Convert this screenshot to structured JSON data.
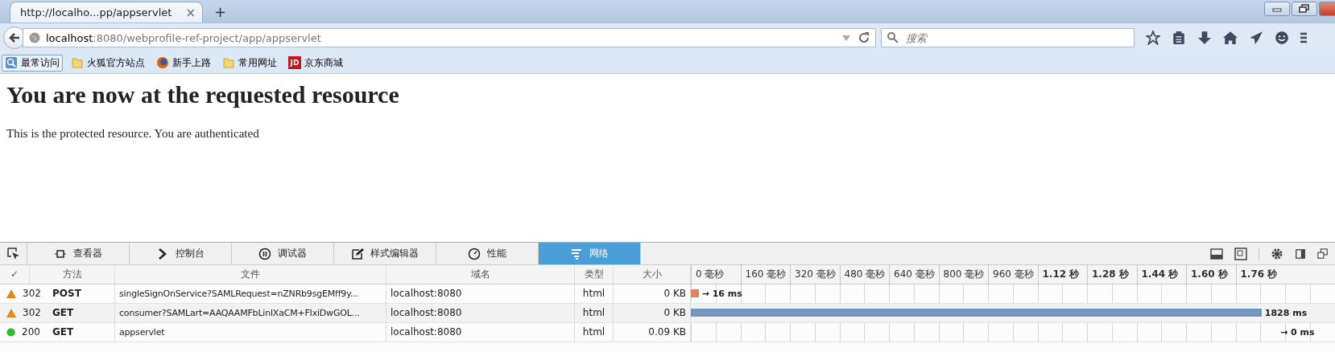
{
  "browser": {
    "tab": {
      "title": "http://localho...pp/appservlet",
      "close": "×"
    },
    "new_tab": "+",
    "address": {
      "host": "localhost",
      "rest": ":8080/webprofile-ref-project/app/appservlet"
    },
    "search": {
      "placeholder": "搜索"
    },
    "bookmarks": [
      {
        "label": "最常访问",
        "kind": "recent",
        "selected": true
      },
      {
        "label": "火狐官方站点",
        "kind": "folder",
        "selected": false
      },
      {
        "label": "新手上路",
        "kind": "firefox",
        "selected": false
      },
      {
        "label": "常用网址",
        "kind": "folder",
        "selected": false
      },
      {
        "label": "京东商城",
        "kind": "logo",
        "logo_text": "JD",
        "selected": false
      }
    ]
  },
  "page": {
    "heading": "You are now at the requested resource",
    "paragraph": "This is the protected resource. You are authenticated"
  },
  "devtools": {
    "tabs": [
      {
        "label": "查看器",
        "kind": "inspector",
        "selected": false
      },
      {
        "label": "控制台",
        "kind": "console",
        "selected": false
      },
      {
        "label": "调试器",
        "kind": "debugger",
        "selected": false
      },
      {
        "label": "样式编辑器",
        "kind": "style",
        "selected": false
      },
      {
        "label": "性能",
        "kind": "performance",
        "selected": false
      },
      {
        "label": "网络",
        "kind": "network",
        "selected": true
      }
    ],
    "columns": [
      "✓",
      "方法",
      "文件",
      "域名",
      "类型",
      "大小"
    ],
    "ticks": [
      {
        "label": "0 毫秒",
        "bold": false
      },
      {
        "label": "160 毫秒",
        "bold": false
      },
      {
        "label": "320 毫秒",
        "bold": false
      },
      {
        "label": "480 毫秒",
        "bold": false
      },
      {
        "label": "640 毫秒",
        "bold": false
      },
      {
        "label": "800 毫秒",
        "bold": false
      },
      {
        "label": "960 毫秒",
        "bold": false
      },
      {
        "label": "1.12 秒",
        "bold": true
      },
      {
        "label": "1.28 秒",
        "bold": true
      },
      {
        "label": "1.44 秒",
        "bold": true
      },
      {
        "label": "1.60 秒",
        "bold": true
      },
      {
        "label": "1.76 秒",
        "bold": true
      }
    ],
    "requests": [
      {
        "kind": "warning",
        "status": "302",
        "method": "POST",
        "file": "singleSignOnService?SAMLRequest=nZNRb9sgEMff9y...",
        "domain": "localhost:8080",
        "type": "html",
        "size": "0 KB",
        "bar": {
          "kind": "blocked",
          "level": 0.012
        },
        "timing": "→ 16 ms"
      },
      {
        "kind": "warning",
        "status": "302",
        "method": "GET",
        "file": "consumer?SAMLart=AAQAAMFbLinlXaCM+FIxiDwGOL...",
        "domain": "localhost:8080",
        "type": "html",
        "size": "0 KB",
        "bar": {
          "kind": "waiting",
          "level": 0.886
        },
        "timing": "1828 ms"
      },
      {
        "kind": "ok",
        "status": "200",
        "method": "GET",
        "file": "appservlet",
        "domain": "localhost:8080",
        "type": "html",
        "size": "0.09 KB",
        "timing": "→ 0 ms"
      }
    ]
  }
}
